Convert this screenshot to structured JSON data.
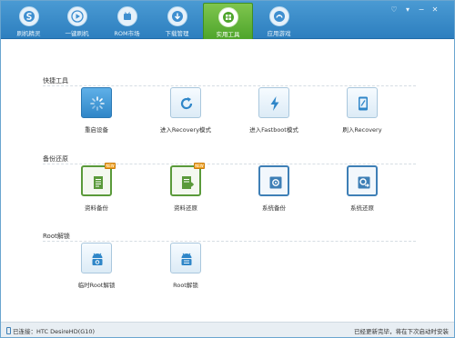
{
  "nav": {
    "tabs": [
      {
        "label": "刷机精灵",
        "icon": "logo-s-icon"
      },
      {
        "label": "一键刷机",
        "icon": "play-icon"
      },
      {
        "label": "ROM市场",
        "icon": "rom-icon"
      },
      {
        "label": "下载管理",
        "icon": "download-icon"
      },
      {
        "label": "实用工具",
        "icon": "grid-icon",
        "active": true
      },
      {
        "label": "应用游戏",
        "icon": "game-icon"
      }
    ]
  },
  "sections": {
    "quick": {
      "title": "快捷工具",
      "items": [
        {
          "label": "重启设备",
          "icon": "spinner-icon"
        },
        {
          "label": "进入Recovery模式",
          "icon": "refresh-icon"
        },
        {
          "label": "进入Fastboot模式",
          "icon": "lightning-icon"
        },
        {
          "label": "刷入Recovery",
          "icon": "phone-icon"
        }
      ]
    },
    "backup": {
      "title": "备份还原",
      "items": [
        {
          "label": "资料备份",
          "icon": "document-icon",
          "badge": "NEW"
        },
        {
          "label": "资料还原",
          "icon": "document-restore-icon",
          "badge": "NEW"
        },
        {
          "label": "系统备份",
          "icon": "system-backup-icon"
        },
        {
          "label": "系统还原",
          "icon": "system-restore-icon"
        }
      ]
    },
    "root": {
      "title": "Root解锁",
      "items": [
        {
          "label": "临时Root解锁",
          "icon": "android-lock-icon"
        },
        {
          "label": "Root解锁",
          "icon": "android-unlock-icon"
        }
      ]
    }
  },
  "status": {
    "connected": "已连接：HTC DesireHD(G10)",
    "update": "已经更新完毕，将在下次启动时安装"
  },
  "colors": {
    "nav_bg": "#2d7fbf",
    "active_tab": "#4ea52b",
    "tile_blue": "#2f86c8"
  }
}
